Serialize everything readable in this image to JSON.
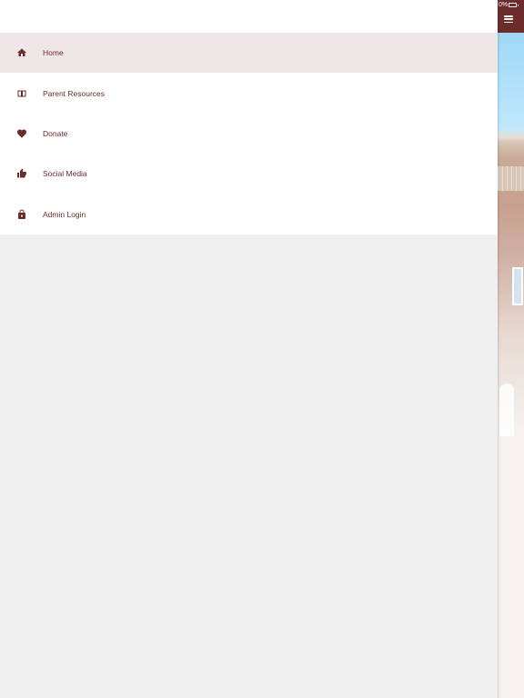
{
  "status": {
    "battery_percent": "0%"
  },
  "drawer": {
    "menu_items": [
      {
        "label": "Home",
        "icon": "home-icon",
        "active": true
      },
      {
        "label": "Parent Resources",
        "icon": "book-icon",
        "active": false
      },
      {
        "label": "Donate",
        "icon": "heart-icon",
        "active": false
      },
      {
        "label": "Social Media",
        "icon": "thumbs-up-icon",
        "active": false
      },
      {
        "label": "Admin Login",
        "icon": "lock-icon",
        "active": false
      }
    ]
  },
  "colors": {
    "brand": "#6c2c2c",
    "selected_background": "#efe7e7",
    "drawer_background": "#ffffff",
    "page_background": "#efefef"
  }
}
